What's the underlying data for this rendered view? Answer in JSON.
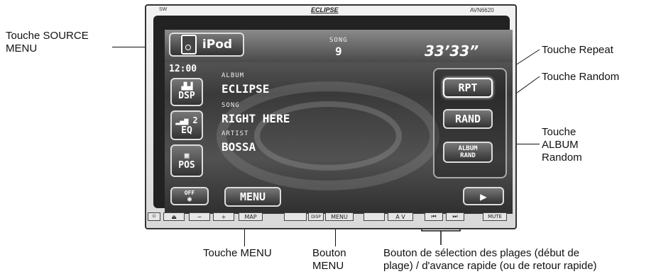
{
  "device": {
    "brand_small": "SW",
    "brand": "ECLIPSE",
    "model": "AVN6620"
  },
  "screen": {
    "source_label": "iPod",
    "song_label": "SONG",
    "song_number": "9",
    "time": "33’33”",
    "clock": "12:00",
    "side_buttons": [
      "DSP",
      "EQ",
      "POS"
    ],
    "eq_number": "2",
    "off_label": "OFF",
    "album_label": "ALBUM",
    "album_value": "ECLIPSE",
    "song_field_label": "SONG",
    "song_value": "RIGHT HERE",
    "artist_label": "ARTIST",
    "artist_value": "BOSSA",
    "menu_button": "MENU",
    "rpt_button": "RPT",
    "rand_button": "RAND",
    "album_rand_line1": "ALBUM",
    "album_rand_line2": "RAND"
  },
  "hardware": {
    "minus": "−",
    "plus": "+",
    "map": "MAP",
    "disp": "DISP",
    "menu": "MENU",
    "av": "A V",
    "mute": "MUTE"
  },
  "callouts": {
    "source_menu": [
      "Touche SOURCE",
      "MENU"
    ],
    "repeat": "Touche Repeat",
    "random": "Touche Random",
    "album_random": [
      "Touche",
      "ALBUM",
      "Random"
    ],
    "menu_touch": "Touche MENU",
    "menu_button": [
      "Bouton",
      "MENU"
    ],
    "track_select": [
      "Bouton de sélection des plages (début de",
      "plage) / d'avance rapide (ou de retour rapide)"
    ]
  }
}
